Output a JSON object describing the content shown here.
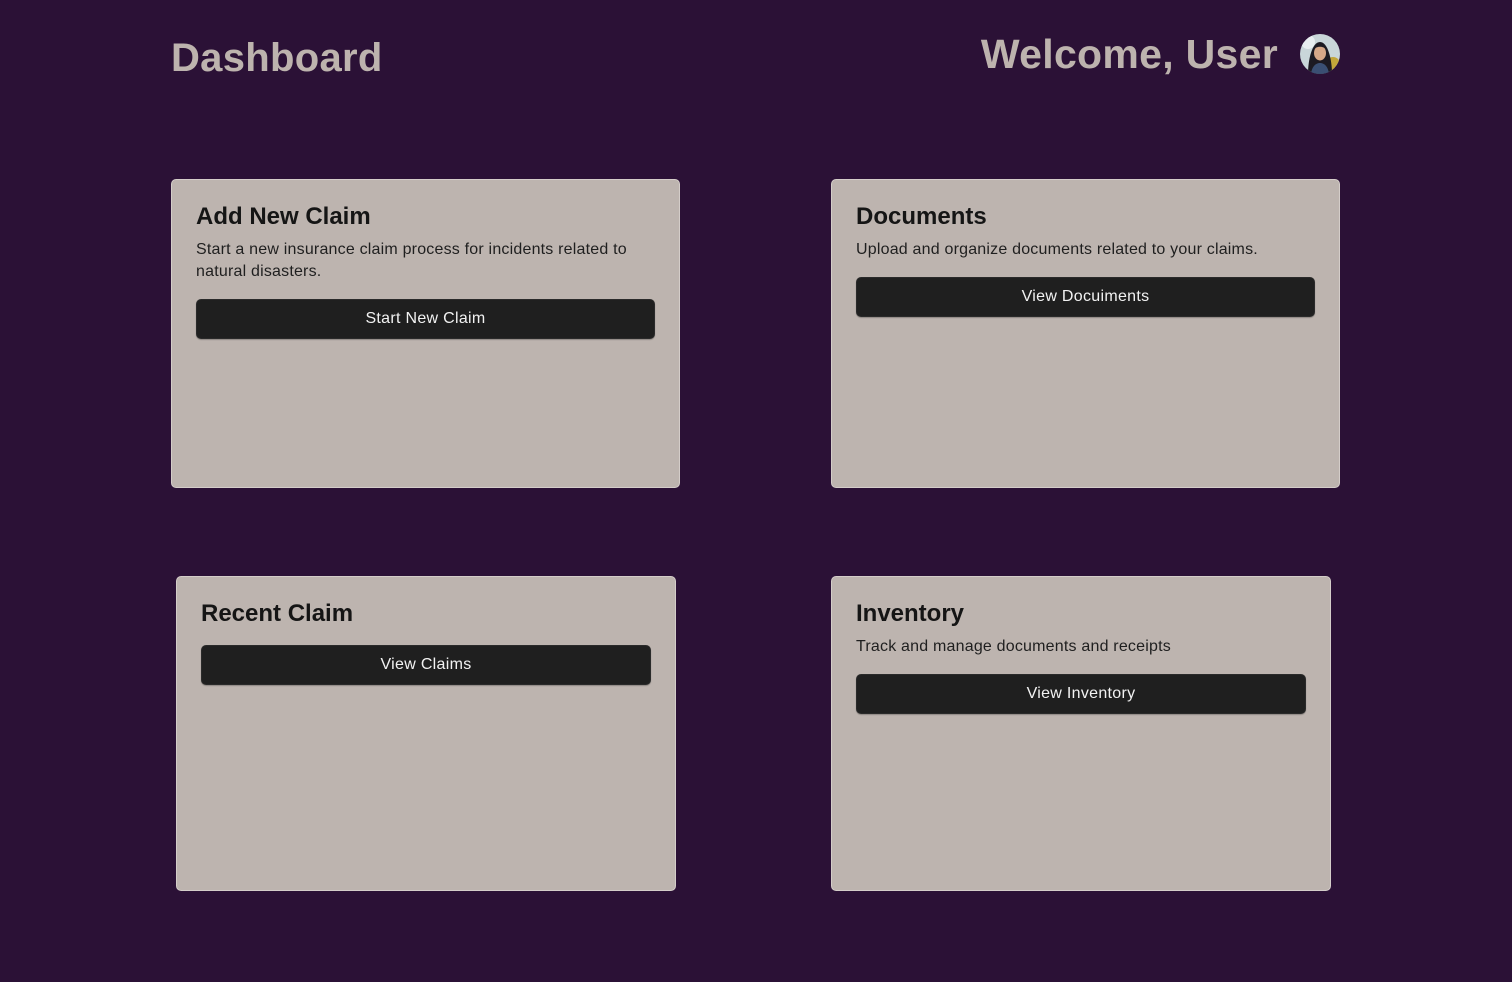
{
  "header": {
    "title": "Dashboard",
    "welcome": "Welcome, User",
    "avatar_icon": "user-avatar-icon"
  },
  "cards": {
    "add_claim": {
      "title": "Add New Claim",
      "description": "Start a new insurance claim process for incidents related to natural disasters.",
      "button": "Start New Claim"
    },
    "documents": {
      "title": "Documents",
      "description": "Upload and organize documents related to your claims.",
      "button": "View Docuiments"
    },
    "recent_claim": {
      "title": "Recent Claim",
      "button": "View Claims"
    },
    "inventory": {
      "title": "Inventory",
      "description": "Track and manage documents and receipts",
      "button": "View Inventory"
    }
  },
  "colors": {
    "background": "#2b1136",
    "card": "#bdb4af",
    "button": "#1f1f1f",
    "header_text": "#bdb3ae"
  }
}
